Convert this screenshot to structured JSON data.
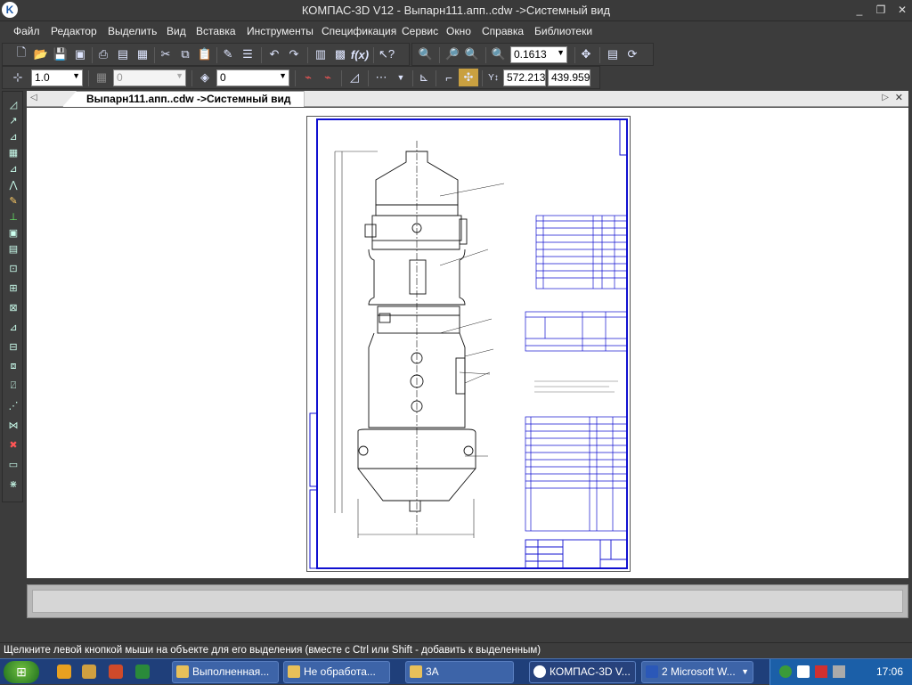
{
  "window": {
    "title": "КОМПАС-3D V12 - Выпарн111.апп..cdw ->Системный вид",
    "app_icon_letter": "K"
  },
  "menu": [
    "Файл",
    "Редактор",
    "Выделить",
    "Вид",
    "Вставка",
    "Инструменты",
    "Спецификация",
    "Сервис",
    "Окно",
    "Справка",
    "Библиотеки"
  ],
  "toolbar1": {
    "zoom_value": "0.1613"
  },
  "toolbar2": {
    "line_width": "1.0",
    "disabled_value": "0",
    "layer_value": "0",
    "coord_x": "572.213",
    "coord_y": "439.959",
    "coord_label": "Y"
  },
  "document": {
    "tab_title": "Выпарн111.апп..cdw ->Системный вид"
  },
  "status": {
    "hint": "Щелкните левой кнопкой мыши на объекте для его выделения (вместе с Ctrl или Shift - добавить к выделенным)"
  },
  "taskbar": {
    "items": [
      {
        "label": "Выполненная...",
        "icon": "folder-icon",
        "active": false
      },
      {
        "label": "Не обработа...",
        "icon": "folder-icon",
        "active": false
      },
      {
        "label": "3А",
        "icon": "folder-icon",
        "active": false
      },
      {
        "label": "КОМПАС-3D V...",
        "icon": "kompas-icon",
        "active": true
      },
      {
        "label": "2 Microsoft W...",
        "icon": "word-icon",
        "active": false
      }
    ],
    "clock": "17:06"
  }
}
